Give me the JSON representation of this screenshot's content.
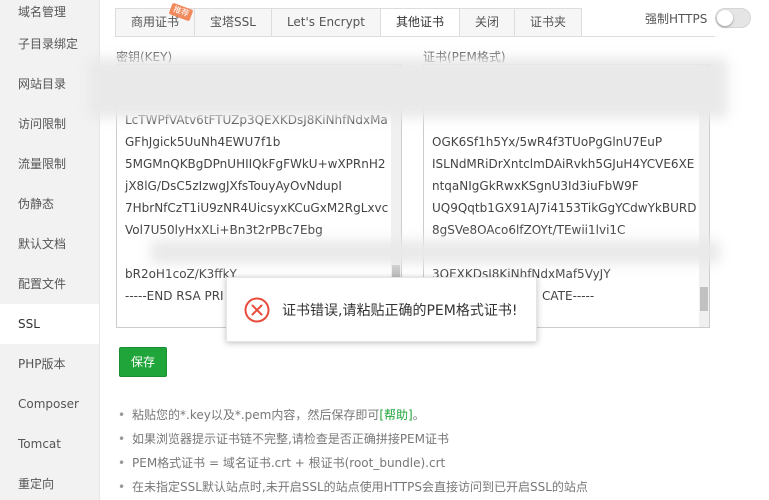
{
  "sidebar": {
    "items": [
      {
        "label": "域名管理"
      },
      {
        "label": "子目录绑定"
      },
      {
        "label": "网站目录"
      },
      {
        "label": "访问限制"
      },
      {
        "label": "流量限制"
      },
      {
        "label": "伪静态"
      },
      {
        "label": "默认文档"
      },
      {
        "label": "配置文件"
      },
      {
        "label": "SSL"
      },
      {
        "label": "PHP版本"
      },
      {
        "label": "Composer"
      },
      {
        "label": "Tomcat"
      },
      {
        "label": "重定向"
      }
    ],
    "active_index": 8
  },
  "tabs": [
    {
      "label": "商用证书",
      "badge": "推荐"
    },
    {
      "label": "宝塔SSL"
    },
    {
      "label": "Let's Encrypt"
    },
    {
      "label": "其他证书"
    },
    {
      "label": "关闭"
    },
    {
      "label": "证书夹"
    }
  ],
  "active_tab": 3,
  "https": {
    "label": "强制HTTPS",
    "enabled": false
  },
  "key": {
    "label": "密钥(KEY)",
    "lines": [
      "LcTWPfVAtv6tFTUZp3QEXKDsJ8KiNhfNdxMa",
      "GFhJgick5UuNh4EWU7f1b",
      "5MGMnQKBgDPnUHIIQkFgFWkU+wXPRnH2",
      "jX8lG/DsC5zIzwgJXfsTouyAyOvNdupI",
      "7HbrNfCzT1iU9zNR4UicsyxKCuGxM2RgLxvc",
      "Vol7U50lyHxXLi+Bn3t2rPBc7Ebg",
      "",
      "bR2oH1coZ/K3ffkY",
      "-----END RSA PRI"
    ]
  },
  "cert": {
    "label": "证书(PEM格式)",
    "lines": [
      "OGK6Sf1h5Yx/5wR4f3TUoPgGlnU7EuP",
      "ISLNdMRiDrXntclmDAiRvkh5GJuH4YCVE6XE",
      "ntqaNIgGkRwxKSgnU3Id3iuFbW9F",
      "UQ9Qqtb1GX91AJ7i4153TikGgYCdwYkBURD",
      "8gSVe8OAco6lfZOYt/TEwii1lvi1C",
      "",
      "3QEXKDsJ8KiNhfNdxMaf5VyJY",
      "CATE-----"
    ]
  },
  "save_label": "保存",
  "notes": {
    "n1_prefix": "粘贴您的*.key以及*.pem内容，然后保存即可",
    "n1_help": "[帮助]",
    "n1_suffix": "。",
    "n2": "如果浏览器提示证书链不完整,请检查是否正确拼接PEM证书",
    "n3": "PEM格式证书 = 域名证书.crt + 根证书(root_bundle).crt",
    "n4": "在未指定SSL默认站点时,未开启SSL的站点使用HTTPS会直接访问到已开启SSL的站点"
  },
  "toast": {
    "message": "证书错误,请粘贴正确的PEM格式证书!"
  },
  "colors": {
    "accent": "#20a53a",
    "error": "#e84c3d",
    "badge": "#f08a5d"
  }
}
